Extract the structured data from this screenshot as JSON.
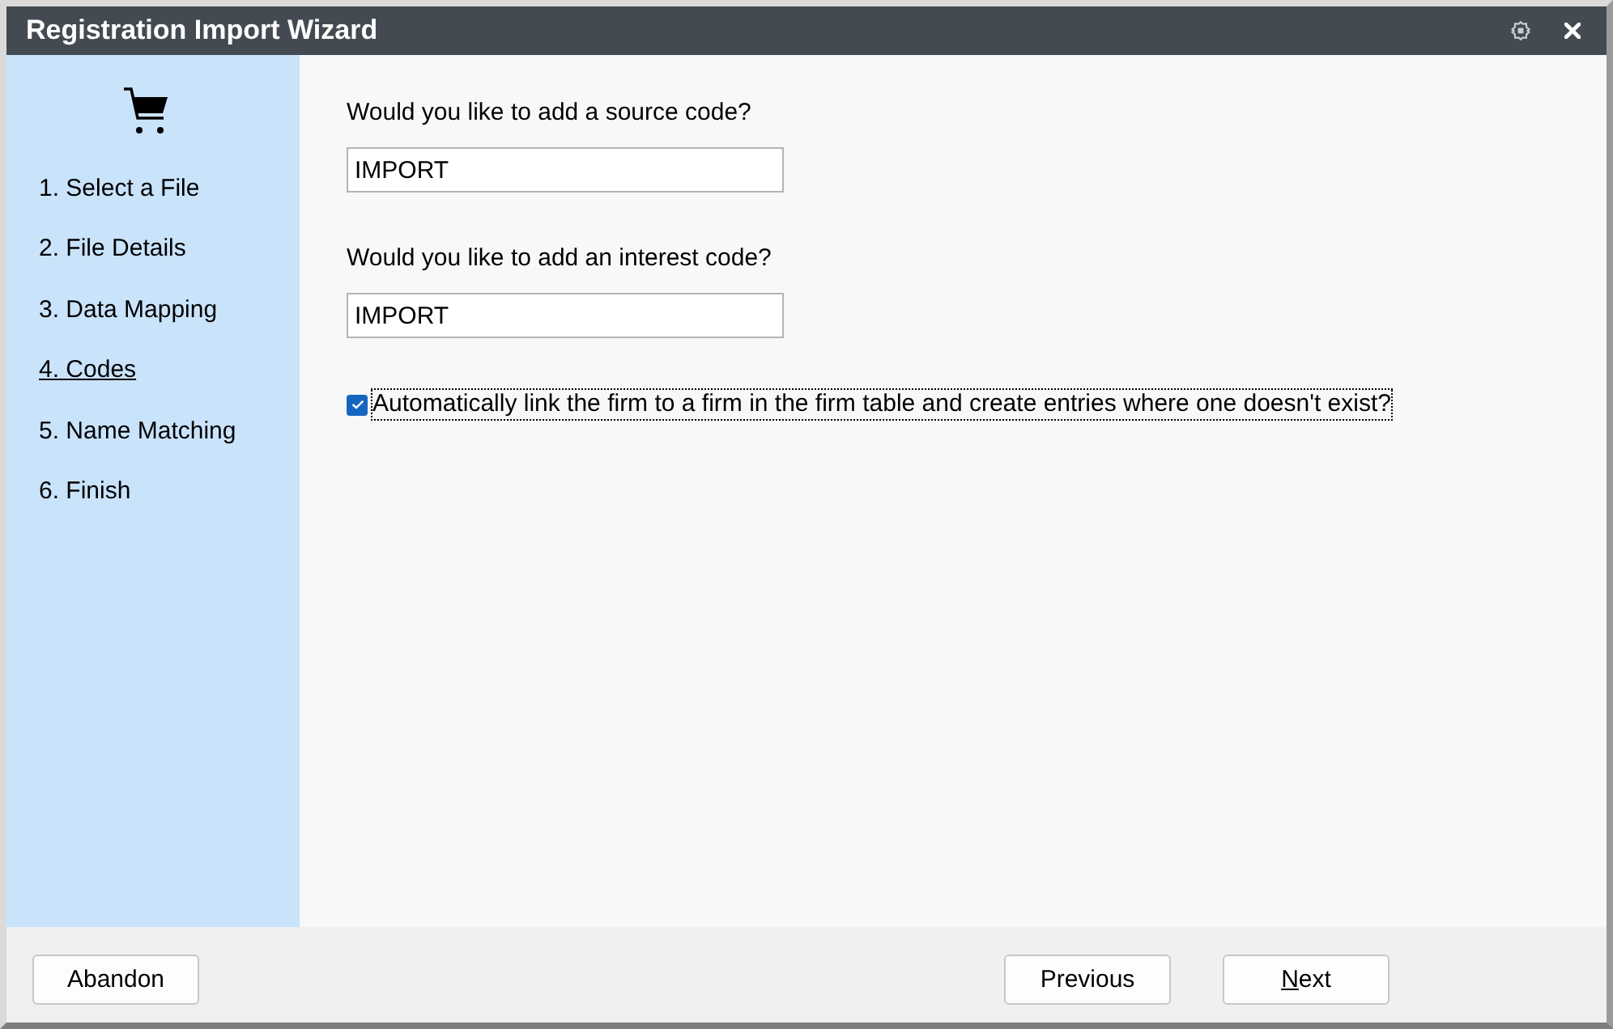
{
  "window": {
    "title": "Registration Import Wizard"
  },
  "steps": [
    {
      "label": "1. Select a File",
      "selected": false
    },
    {
      "label": "2. File Details",
      "selected": false
    },
    {
      "label": "3. Data Mapping",
      "selected": false
    },
    {
      "label": "4. Codes",
      "selected": true
    },
    {
      "label": "5. Name Matching",
      "selected": false
    },
    {
      "label": "6. Finish",
      "selected": false
    }
  ],
  "questions": [
    {
      "label": "Would you like to add a source code?",
      "value": "IMPORT"
    },
    {
      "label": "Would you like to add an interest code?",
      "value": "IMPORT"
    }
  ],
  "auto_link": {
    "label": "Automatically link the firm to a firm in the firm table and create entries where one doesn't exist?",
    "checked": true,
    "focused": true
  },
  "footer": {
    "left_buttons": [
      {
        "label": "Abandon",
        "mnemonic": false
      }
    ],
    "right_buttons": [
      {
        "label": "Previous",
        "mnemonic": false
      },
      {
        "label": "Next",
        "mnemonic": true
      }
    ]
  }
}
